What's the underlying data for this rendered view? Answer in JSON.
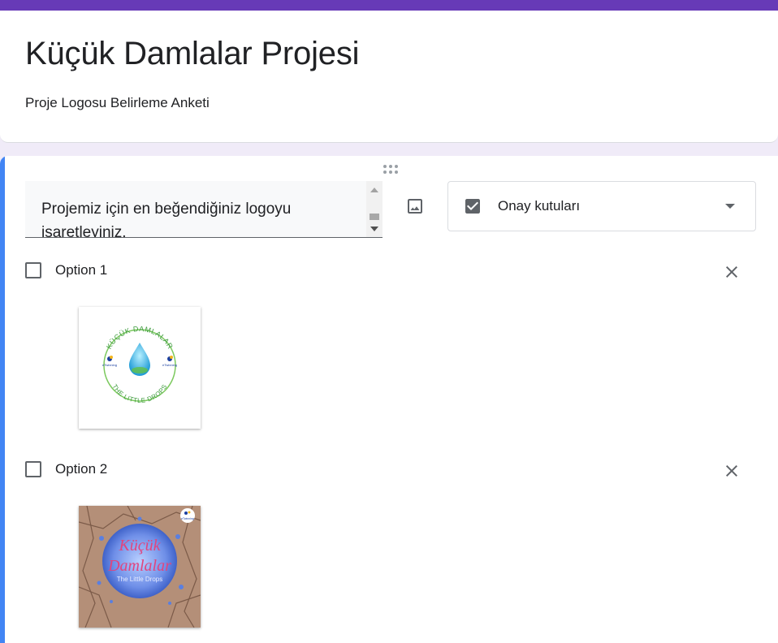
{
  "form": {
    "title": "Küçük Damlalar Projesi",
    "description": "Proje Logosu Belirleme Anketi",
    "accent_color": "#673ab7"
  },
  "question": {
    "text": "Projemiz için en beğendiğiniz logoyu işaretleyiniz.",
    "type_label": "Onay kutuları",
    "active_color": "#4285f4"
  },
  "options": [
    {
      "label": "Option 1",
      "image": {
        "ring_top_text": "KÜÇÜK DAMLALAR",
        "ring_bottom_text": "THE LITTLE DROPS",
        "badge_text": "eTwinning"
      }
    },
    {
      "label": "Option 2",
      "image": {
        "title_line1": "Küçük",
        "title_line2": "Damlalar",
        "subtitle": "The Little Drops",
        "badge_text": "eTwinning"
      }
    }
  ],
  "icons": {
    "drag": "drag-handle-icon",
    "image": "image-icon",
    "checkbox_type": "checkbox-checked-icon",
    "dropdown": "chevron-down-icon",
    "remove": "close-icon"
  }
}
